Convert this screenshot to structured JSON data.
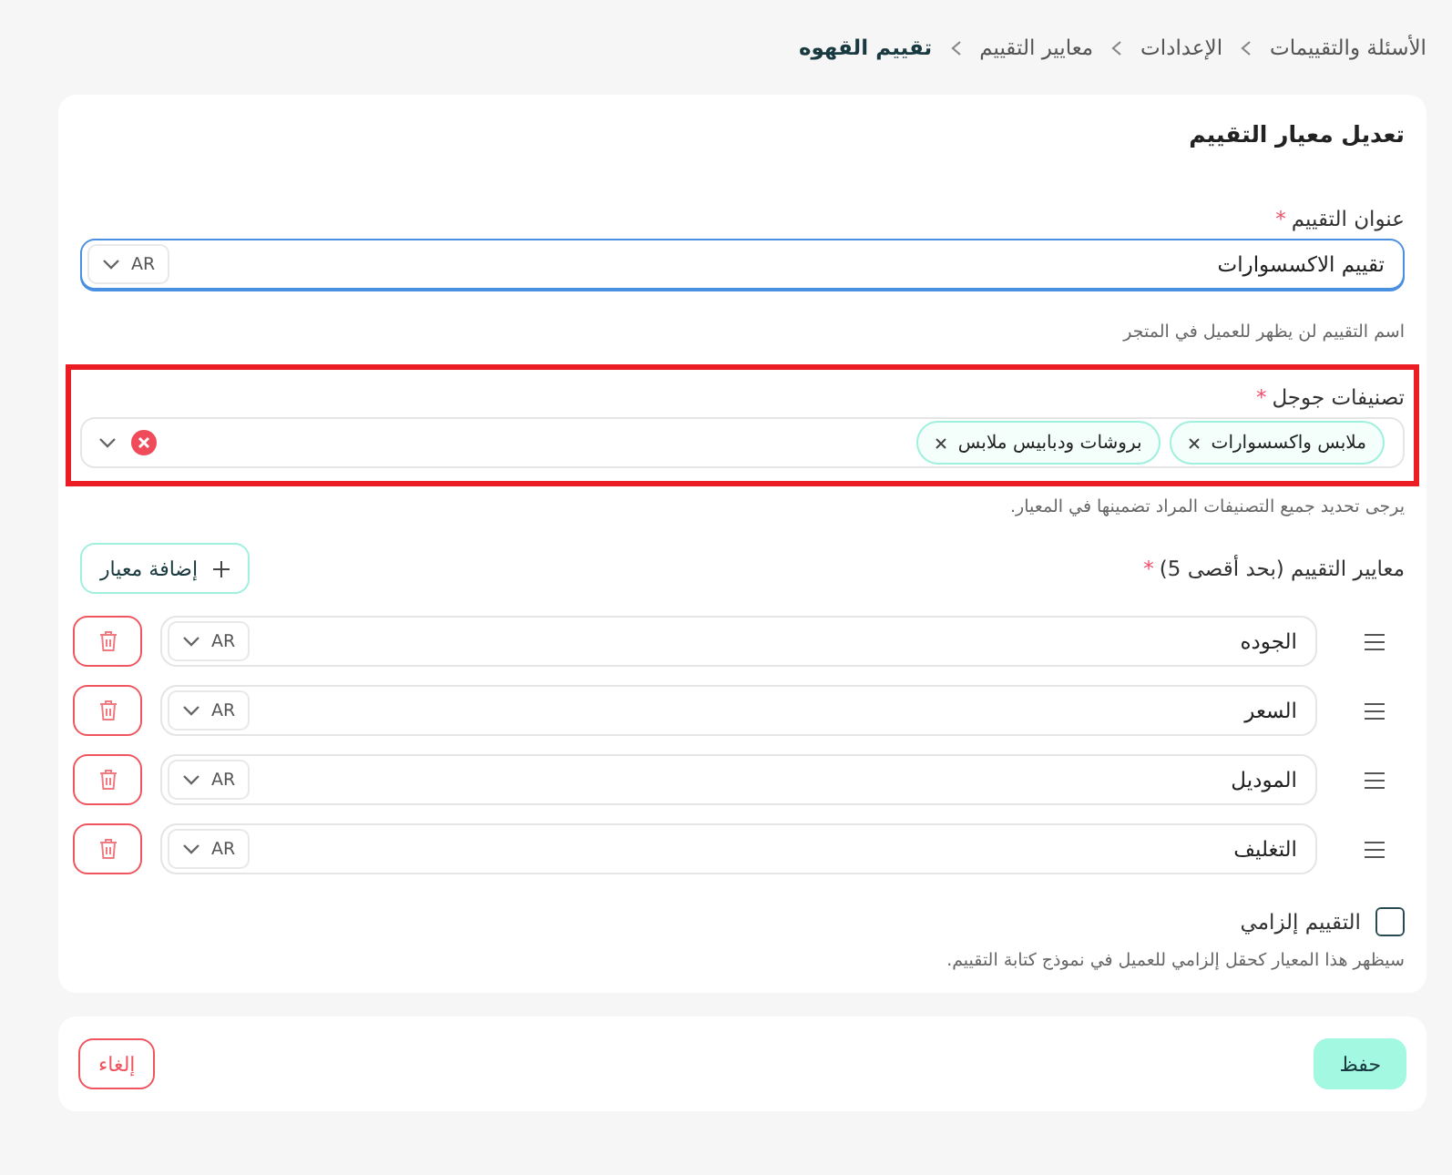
{
  "breadcrumb": [
    {
      "label": "الأسئلة والتقييمات",
      "selected": false
    },
    {
      "label": "الإعدادات",
      "selected": false
    },
    {
      "label": "معايير التقييم",
      "selected": false
    },
    {
      "label": "تقييم القهوه",
      "selected": true
    }
  ],
  "form": {
    "title": "تعديل معيار التقييم",
    "name_field": {
      "label": "عنوان التقييم",
      "required_mark": "*",
      "value": "تقييم الاكسسوارات",
      "language": "AR",
      "focused": true,
      "help": "اسم التقييم لن يظهر للعميل في المتجر"
    },
    "categories_field": {
      "label": "تصنيفات جوجل",
      "required_mark": "*",
      "highlighted": true,
      "chips": [
        {
          "label": "ملابس واكسسوارات"
        },
        {
          "label": "بروشات ودبابيس ملابس"
        }
      ],
      "help": "يرجى تحديد جميع التصنيفات المراد تضمينها في المعيار."
    },
    "criteria": {
      "label": "معايير التقييم (بحد أقصى 5)",
      "required_mark": "*",
      "add_button": "إضافة معيار",
      "items": [
        {
          "value": "الجوده",
          "language": "AR"
        },
        {
          "value": "السعر",
          "language": "AR"
        },
        {
          "value": "الموديل",
          "language": "AR"
        },
        {
          "value": "التغليف",
          "language": "AR"
        }
      ]
    },
    "mandatory": {
      "label": "التقييم إلزامي",
      "checked": false,
      "help": "سيظهر هذا المعيار كحقل إلزامي للعميل في نموذج كتابة التقييم."
    }
  },
  "footer": {
    "save": "حفظ",
    "cancel": "إلغاء"
  }
}
